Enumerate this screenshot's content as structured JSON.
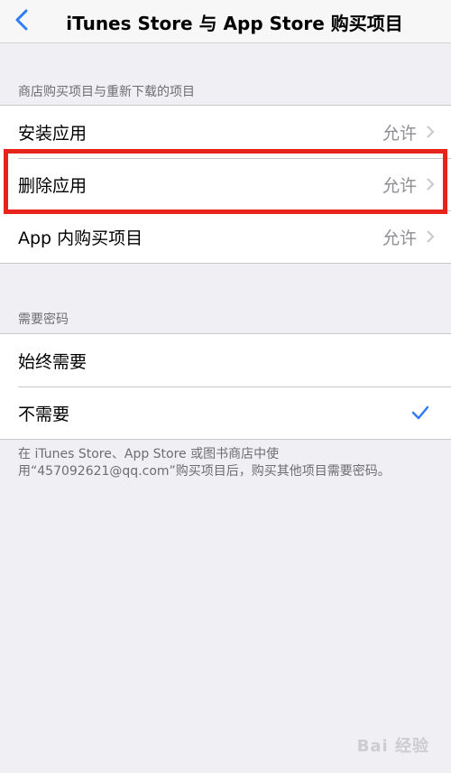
{
  "navbar": {
    "title": "iTunes Store 与 App Store 购买项目",
    "back_icon": "chevron-left-icon",
    "accent_color": "#2f7cf6"
  },
  "section1": {
    "header": "商店购买项目与重新下载的项目",
    "rows": [
      {
        "label": "安装应用",
        "value": "允许"
      },
      {
        "label": "删除应用",
        "value": "允许"
      },
      {
        "label": "App 内购买项目",
        "value": "允许"
      }
    ]
  },
  "section2": {
    "header": "需要密码",
    "rows": [
      {
        "label": "始终需要",
        "checked": false
      },
      {
        "label": "不需要",
        "checked": true
      }
    ]
  },
  "footer": {
    "note": "在 iTunes Store、App Store 或图书商店中使用“457092621@qq.com”购买项目后，购买其他项目需要密码。"
  },
  "watermark": "Bai 经验",
  "highlight_color": "#e8231c"
}
